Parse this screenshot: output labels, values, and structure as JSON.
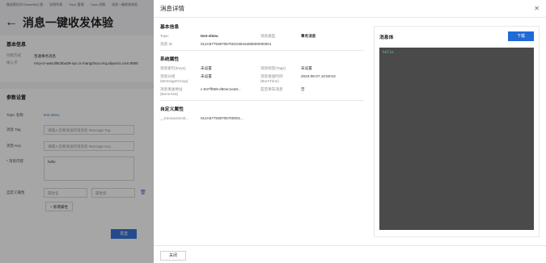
{
  "background": {
    "crumbs": [
      "微消息队列 RocketMQ 版",
      "实例列表",
      "Topic 管理",
      "Topic 详情",
      "消息一键收发体验"
    ],
    "page_title": "消息一键收发体验",
    "basic_title": "基本信息",
    "basic": [
      {
        "k": "付款方式",
        "v": "普通事务消息"
      },
      {
        "k": "接入点",
        "v": "rmq-cn-wwo3l8c5bu09-vpc.cn-hangzhou.rmq.aliyuncs.com:8080"
      }
    ],
    "params_title": "参数设置",
    "topic_label": "Topic 名称",
    "topic_value": "test-shieu",
    "tag_label": "消息 Tag",
    "tag_placeholder": "请输入您要发送的消息的 Message Tag...",
    "key_label": "消息 Key",
    "key_placeholder": "请输入您要发送的消息的 Message Key...",
    "content_label": "* 消息内容",
    "content_value": "hello",
    "custom_label": "自定义属性",
    "attr_name_placeholder": "属性名",
    "attr_value_placeholder": "属性值",
    "add_label": "+ 新增属性",
    "send_label": "发送"
  },
  "drawer": {
    "title": "消息详情",
    "basic_title": "基本信息",
    "basic": [
      {
        "k": "Topic",
        "v": "test-shieu",
        "bold": true,
        "k2": "消息类型",
        "v2": "事务消息",
        "bold2": true
      },
      {
        "k": "消息 ID",
        "v": "012A577938705700104916458000000001",
        "k2": "",
        "v2": ""
      }
    ],
    "system_title": "系统属性",
    "system": [
      {
        "k": "消息索引(Keys)",
        "v": "未设置",
        "k2": "消息标签(Tags)",
        "v2": "未设置"
      },
      {
        "k": "消息分组 (MessageGroup)",
        "v": "未设置",
        "k2": "消息发送时间 (BornTime)",
        "v2": "2023-06-07 10:50:03"
      },
      {
        "k": "消息发送地址 (BornHost)",
        "v": "c-647ff056-d9eec1ea9...",
        "k2": "是否单向消息",
        "v2": "否"
      }
    ],
    "custom_title": "自定义属性",
    "custom": [
      {
        "k": "__transactionId...",
        "v": "012A577938705700001..."
      }
    ],
    "body_title": "消息体",
    "download_label": "下载",
    "body_content": "hello",
    "close_label": "关闭"
  }
}
